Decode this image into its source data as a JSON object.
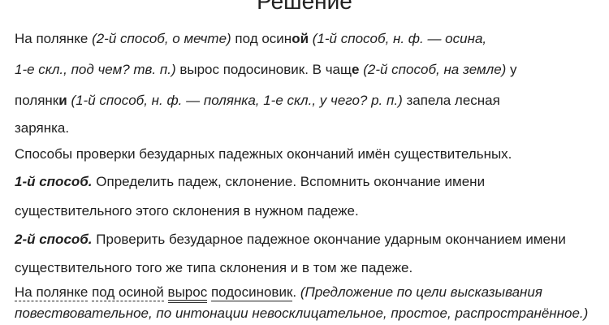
{
  "title": "Решение",
  "lines": [
    {
      "parts": [
        "На полянке ",
        "(2-й способ, о мечте)",
        " под осин",
        "ой",
        " ",
        "(1-й способ, н. ф. — осина,"
      ]
    },
    {
      "parts": [
        "1-е скл., под чем? тв. п.)",
        " вырос подосиновик. В чащ",
        "е",
        " ",
        "(2-й способ, на земле)",
        " у"
      ]
    },
    {
      "parts": [
        "полянк",
        "и",
        " ",
        "(1-й способ, н. ф. — полянка, 1-е скл., у чего? р. п.)",
        " запела лесная"
      ]
    },
    {
      "parts": [
        "зарянка."
      ]
    },
    {
      "parts": [
        "Способы проверки безударных падежных окончаний имён существительных."
      ]
    },
    {
      "parts": [
        "1-й способ.",
        " Определить падеж, склонение. Вспомнить окончание имени"
      ]
    },
    {
      "parts": [
        "существительного этого склонения в нужном падеже."
      ]
    },
    {
      "parts": [
        "2-й способ.",
        " Проверить безударное падежное окончание ударным окончанием имени"
      ]
    },
    {
      "parts": [
        "существительного того же типа склонения и в том же падеже."
      ]
    },
    {
      "parts": [
        "На полянке",
        " ",
        "под осиной",
        " ",
        "вырос",
        " ",
        "подосиновик",
        ". ",
        "(Предложение по цели высказывания"
      ]
    },
    {
      "parts": [
        "повествовательное, по интонации невосклицательное, простое, распространённое.)"
      ]
    }
  ]
}
